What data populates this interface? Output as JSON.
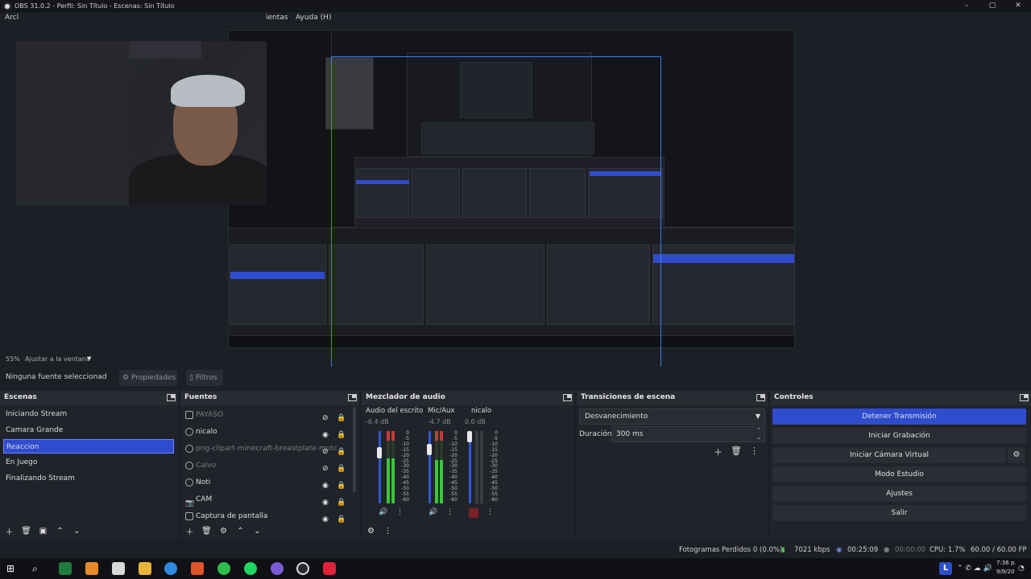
{
  "window": {
    "title": "OBS 31.0.2 - Perfil: Sin Título - Escenas: Sin Título",
    "min": "–",
    "max": "▢",
    "close": "✕"
  },
  "menu": {
    "file_partial": "Arcl",
    "tools_partial": "ientas",
    "help": "Ayuda (H)"
  },
  "preview": {
    "zoom": "55%",
    "fit": "Ajustar a la ventana"
  },
  "properties_bar": {
    "source": "Ninguna fuente seleccionad",
    "properties": "Propiedades",
    "filters": "Filtros"
  },
  "scenes": {
    "title": "Escenas",
    "items": [
      {
        "label": "Iniciando Stream"
      },
      {
        "label": "Camara Grande"
      },
      {
        "label": "Reaccion"
      },
      {
        "label": "En Juego"
      },
      {
        "label": "Finalizando Stream"
      }
    ]
  },
  "sources": {
    "title": "Fuentes",
    "items": [
      {
        "label": "PAYASO"
      },
      {
        "label": "nicalo"
      },
      {
        "label": "png-clipart-minecraft-breastplate-motc"
      },
      {
        "label": "Calvo"
      },
      {
        "label": "Noti"
      },
      {
        "label": "CAM"
      },
      {
        "label": "Captura de pantalla"
      }
    ]
  },
  "mixer": {
    "title": "Mezclador de audio",
    "channels": [
      {
        "name": "Audio del escrito",
        "db": "-6.4 dB",
        "level": 0.62
      },
      {
        "name": "Mic/Aux",
        "db": "-4.7 dB",
        "level": 0.6
      },
      {
        "name": "nicalo",
        "db": "0.0 dB",
        "level": 0.0
      }
    ],
    "scale": [
      "0",
      "-5",
      "-10",
      "-15",
      "-20",
      "-25",
      "-30",
      "-35",
      "-40",
      "-45",
      "-50",
      "-55",
      "-60"
    ]
  },
  "transitions": {
    "title": "Transiciones de escena",
    "selected": "Desvanecimiento",
    "duration_label": "Duración",
    "duration_value": "300 ms"
  },
  "controls": {
    "title": "Controles",
    "stop_stream": "Detener Transmisión",
    "start_recording": "Iniciar Grabación",
    "start_virtual_cam": "Iniciar Cámara Virtual",
    "studio_mode": "Modo Estudio",
    "settings": "Ajustes",
    "exit": "Salir"
  },
  "status": {
    "dropped_frames": "Fotogramas Perdidos 0 (0.0%)",
    "bitrate": "7021 kbps",
    "stream_time": "00:25:09",
    "rec_time": "00:00:00",
    "cpu": "CPU: 1.7%",
    "fps": "60.00 / 60.00 FP"
  },
  "taskbar": {
    "clock_time": "7:36 p.",
    "clock_date": "9/9/20",
    "lang": "L"
  },
  "colors": {
    "accent": "#2f4ccf",
    "bg": "#1d1f26",
    "dock": "#21232a",
    "meter_green": "#3ec43e"
  }
}
